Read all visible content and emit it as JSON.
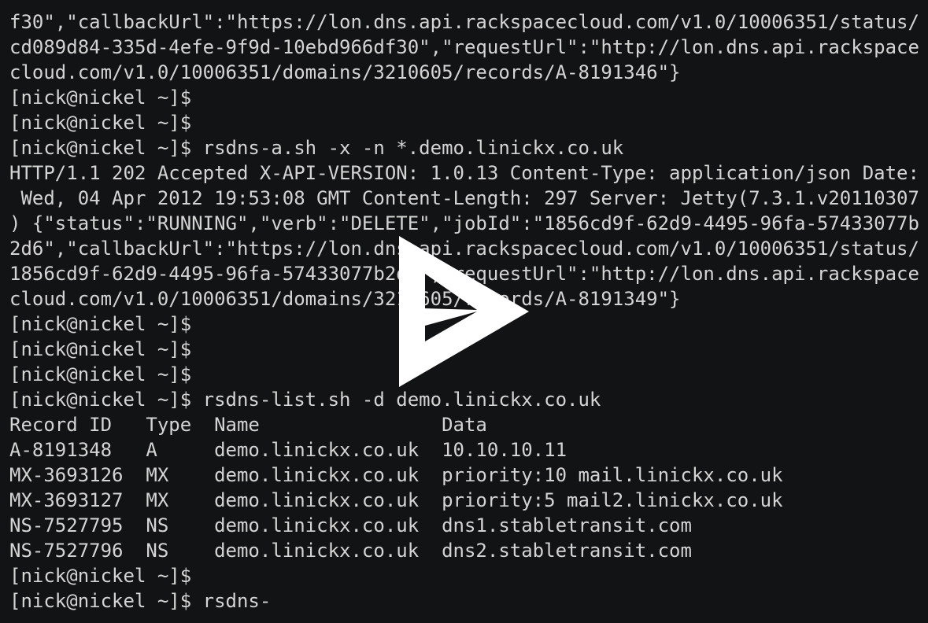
{
  "terminal": {
    "lines": [
      "f30\",\"callbackUrl\":\"https://lon.dns.api.rackspacecloud.com/v1.0/10006351/status/",
      "cd089d84-335d-4efe-9f9d-10ebd966df30\",\"requestUrl\":\"http://lon.dns.api.rackspace",
      "cloud.com/v1.0/10006351/domains/3210605/records/A-8191346\"}",
      "[nick@nickel ~]$",
      "[nick@nickel ~]$",
      "[nick@nickel ~]$ rsdns-a.sh -x -n *.demo.linickx.co.uk",
      "HTTP/1.1 202 Accepted X-API-VERSION: 1.0.13 Content-Type: application/json Date:",
      " Wed, 04 Apr 2012 19:53:08 GMT Content-Length: 297 Server: Jetty(7.3.1.v20110307",
      ") {\"status\":\"RUNNING\",\"verb\":\"DELETE\",\"jobId\":\"1856cd9f-62d9-4495-96fa-57433077b",
      "2d6\",\"callbackUrl\":\"https://lon.dns.api.rackspacecloud.com/v1.0/10006351/status/",
      "1856cd9f-62d9-4495-96fa-57433077b2d6\",\"requestUrl\":\"http://lon.dns.api.rackspace",
      "cloud.com/v1.0/10006351/domains/3210605/records/A-8191349\"}",
      "[nick@nickel ~]$",
      "[nick@nickel ~]$",
      "[nick@nickel ~]$",
      "[nick@nickel ~]$ rsdns-list.sh -d demo.linickx.co.uk",
      "Record ID   Type  Name                Data",
      "A-8191348   A     demo.linickx.co.uk  10.10.10.11",
      "MX-3693126  MX    demo.linickx.co.uk  priority:10 mail.linickx.co.uk",
      "MX-3693127  MX    demo.linickx.co.uk  priority:5 mail2.linickx.co.uk",
      "NS-7527795  NS    demo.linickx.co.uk  dns1.stabletransit.com",
      "NS-7527796  NS    demo.linickx.co.uk  dns2.stabletransit.com",
      "[nick@nickel ~]$",
      "[nick@nickel ~]$ rsdns-"
    ]
  },
  "overlay": {
    "icon": "play-icon",
    "color": "#ffffff"
  },
  "colors": {
    "background": "#121314",
    "text": "#d4d4d4"
  }
}
